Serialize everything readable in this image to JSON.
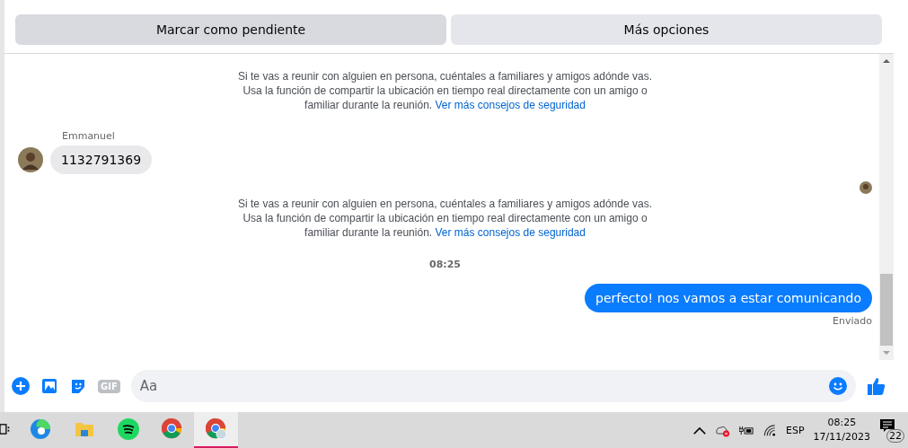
{
  "actions": [
    {
      "label": "Marcar como pendiente",
      "selected": true
    },
    {
      "label": "Más opciones",
      "selected": false
    }
  ],
  "messages": [
    {
      "kind": "notice",
      "text": "Si te vas a reunir con alguien en persona, cuéntales a familiares y amigos adónde vas. Usa la función de compartir la ubicación en tiempo real directamente con un amigo o familiar durante la reunión.",
      "link": "Ver más consejos de seguridad"
    },
    {
      "kind": "incoming",
      "sender": "Emmanuel",
      "text": "1132791369"
    },
    {
      "kind": "seen"
    },
    {
      "kind": "notice",
      "text": "Si te vas a reunir con alguien en persona, cuéntales a familiares y amigos adónde vas. Usa la función de compartir la ubicación en tiempo real directamente con un amigo o familiar durante la reunión.",
      "link": "Ver más consejos de seguridad"
    },
    {
      "kind": "time",
      "text": "08:25"
    },
    {
      "kind": "outgoing",
      "text": "perfecto! nos vamos a estar comunicando"
    },
    {
      "kind": "status",
      "text": "Enviado"
    }
  ],
  "composer": {
    "gif_label": "GIF",
    "placeholder": "Aa"
  },
  "taskbar": {
    "apps": [
      {
        "kind": "taskview",
        "selected": false
      },
      {
        "kind": "edge",
        "selected": false
      },
      {
        "kind": "folder",
        "selected": false
      },
      {
        "kind": "spotify",
        "selected": false
      },
      {
        "kind": "chrome",
        "selected": false
      },
      {
        "kind": "chrome-profile",
        "selected": true
      }
    ],
    "language": "ESP",
    "time": "08:25",
    "date": "17/11/2023",
    "notifications": "22"
  }
}
